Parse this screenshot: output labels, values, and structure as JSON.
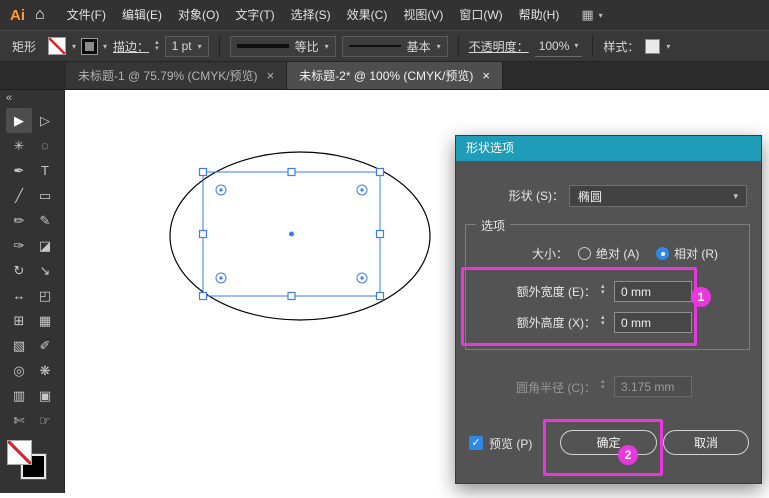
{
  "colors": {
    "dialog_header_teal": "#1e9cb8",
    "annotation_magenta": "#e838dd",
    "selection_blue": "#3a7ef2",
    "accent_blue": "#2f87e6"
  },
  "icons": {
    "home": "⌂",
    "workspace_grid": "▦",
    "chevron_down": "▾",
    "stepper_up": "▴",
    "stepper_down": "▾",
    "collapse_left": "«",
    "check": "✓",
    "close": "×"
  },
  "menubar": {
    "logo": "Ai",
    "items": [
      "文件(F)",
      "编辑(E)",
      "对象(O)",
      "文字(T)",
      "选择(S)",
      "效果(C)",
      "视图(V)",
      "窗口(W)",
      "帮助(H)"
    ]
  },
  "controlbar": {
    "tool_name": "矩形",
    "stroke_label": "描边：",
    "stroke_value": "1 pt",
    "profile_value": "等比",
    "brush_value": "基本",
    "opacity_label": "不透明度：",
    "opacity_value": "100%",
    "style_label": "样式："
  },
  "tabs": [
    {
      "title": "未标题-1 @ 75.79% (CMYK/预览)"
    },
    {
      "title": "未标题-2* @ 100% (CMYK/预览)"
    }
  ],
  "tools": [
    {
      "name": "selection-tool",
      "glyph": "▶"
    },
    {
      "name": "direct-selection-tool",
      "glyph": "▷"
    },
    {
      "name": "magic-wand-tool",
      "glyph": "✳"
    },
    {
      "name": "lasso-tool",
      "glyph": "◌"
    },
    {
      "name": "pen-tool",
      "glyph": "✒"
    },
    {
      "name": "type-tool",
      "glyph": "T"
    },
    {
      "name": "line-segment-tool",
      "glyph": "╱"
    },
    {
      "name": "rectangle-tool",
      "glyph": "▭"
    },
    {
      "name": "paintbrush-tool",
      "glyph": "✏"
    },
    {
      "name": "pencil-tool",
      "glyph": "✎"
    },
    {
      "name": "shaper-tool",
      "glyph": "✑"
    },
    {
      "name": "eraser-tool",
      "glyph": "◪"
    },
    {
      "name": "rotate-tool",
      "glyph": "↻"
    },
    {
      "name": "scale-tool",
      "glyph": "↘"
    },
    {
      "name": "width-tool",
      "glyph": "↔"
    },
    {
      "name": "free-transform-tool",
      "glyph": "◰"
    },
    {
      "name": "perspective-grid-tool",
      "glyph": "⊞"
    },
    {
      "name": "mesh-tool",
      "glyph": "▦"
    },
    {
      "name": "gradient-tool",
      "glyph": "▧"
    },
    {
      "name": "eyedropper-tool",
      "glyph": "✐"
    },
    {
      "name": "blend-tool",
      "glyph": "◎"
    },
    {
      "name": "symbol-sprayer-tool",
      "glyph": "❋"
    },
    {
      "name": "column-graph-tool",
      "glyph": "▥"
    },
    {
      "name": "artboard-tool",
      "glyph": "▣"
    },
    {
      "name": "slice-tool",
      "glyph": "✄"
    },
    {
      "name": "hand-tool",
      "glyph": "☞"
    }
  ],
  "dialog": {
    "title": "形状选项",
    "shape_label": "形状 (S)：",
    "shape_value": "椭圆",
    "group_label": "选项",
    "size_label": "大小：",
    "radio_absolute": "绝对 (A)",
    "radio_relative": "相对 (R)",
    "extra_width_label": "额外宽度 (E)：",
    "extra_width_value": "0 mm",
    "extra_height_label": "额外高度 (X)：",
    "extra_height_value": "0 mm",
    "corner_label": "圆角半径 (C)：",
    "corner_value": "3.175 mm",
    "preview_label": "预览 (P)",
    "ok_label": "确定",
    "cancel_label": "取消"
  },
  "annotations": {
    "step1": "1",
    "step2": "2"
  }
}
